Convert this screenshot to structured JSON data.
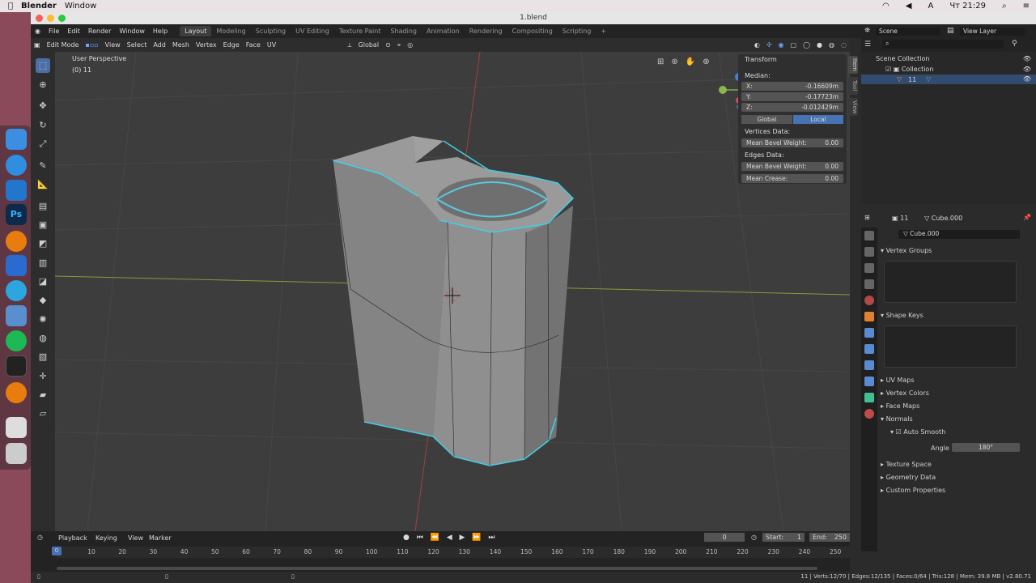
{
  "macbar": {
    "app": "Blender",
    "menu": "Window",
    "time": "Чт 21:29",
    "lang": "A"
  },
  "window": {
    "title": "1.blend"
  },
  "menus": [
    "File",
    "Edit",
    "Render",
    "Window",
    "Help"
  ],
  "workspaces": [
    "Layout",
    "Modeling",
    "Sculpting",
    "UV Editing",
    "Texture Paint",
    "Shading",
    "Animation",
    "Rendering",
    "Compositing",
    "Scripting"
  ],
  "active_workspace": "Layout",
  "scene": "Scene",
  "view_layer": "View Layer",
  "header": {
    "mode": "Edit Mode",
    "items": [
      "View",
      "Select",
      "Add",
      "Mesh",
      "Vertex",
      "Edge",
      "Face",
      "UV"
    ],
    "orientation": "Global"
  },
  "viewport": {
    "perspective": "User Perspective",
    "object": "(0) 11"
  },
  "transform": {
    "title": "Transform",
    "median": "Median:",
    "x_label": "X:",
    "x": "-0.16609m",
    "y_label": "Y:",
    "y": "-0.17723m",
    "z_label": "Z:",
    "z": "-0.012429m",
    "global": "Global",
    "local": "Local",
    "vertices_data": "Vertices Data:",
    "mean_bevel_label": "Mean Bevel Weight:",
    "mean_bevel_v": "0.00",
    "edges_data": "Edges Data:",
    "mean_bevel_e": "0.00",
    "mean_crease_label": "Mean Crease:",
    "mean_crease": "0.00"
  },
  "sidetabs": [
    "Item",
    "Tool",
    "View"
  ],
  "outliner": {
    "scene_collection": "Scene Collection",
    "collection": "Collection",
    "object": "11"
  },
  "props": {
    "object": "11",
    "mesh": "Cube.000",
    "mesh_field": "Cube.000",
    "sections": [
      "Vertex Groups",
      "Shape Keys",
      "UV Maps",
      "Vertex Colors",
      "Face Maps",
      "Normals",
      "Texture Space",
      "Geometry Data",
      "Custom Properties"
    ],
    "auto_smooth": "Auto Smooth",
    "angle_label": "Angle",
    "angle": "180°"
  },
  "timeline": {
    "items": [
      "Playback",
      "Keying",
      "View",
      "Marker"
    ],
    "frame": "0",
    "start_label": "Start:",
    "start": "1",
    "end_label": "End:",
    "end": "250",
    "ticks": [
      "0",
      "10",
      "20",
      "30",
      "40",
      "50",
      "60",
      "70",
      "80",
      "90",
      "100",
      "110",
      "120",
      "130",
      "140",
      "150",
      "160",
      "170",
      "180",
      "190",
      "200",
      "210",
      "220",
      "230",
      "240",
      "250"
    ]
  },
  "status": "11 | Verts:12/70 | Edges:12/135 | Faces:0/64 | Tris:128 | Mem: 39.8 MB | v2.80.71"
}
